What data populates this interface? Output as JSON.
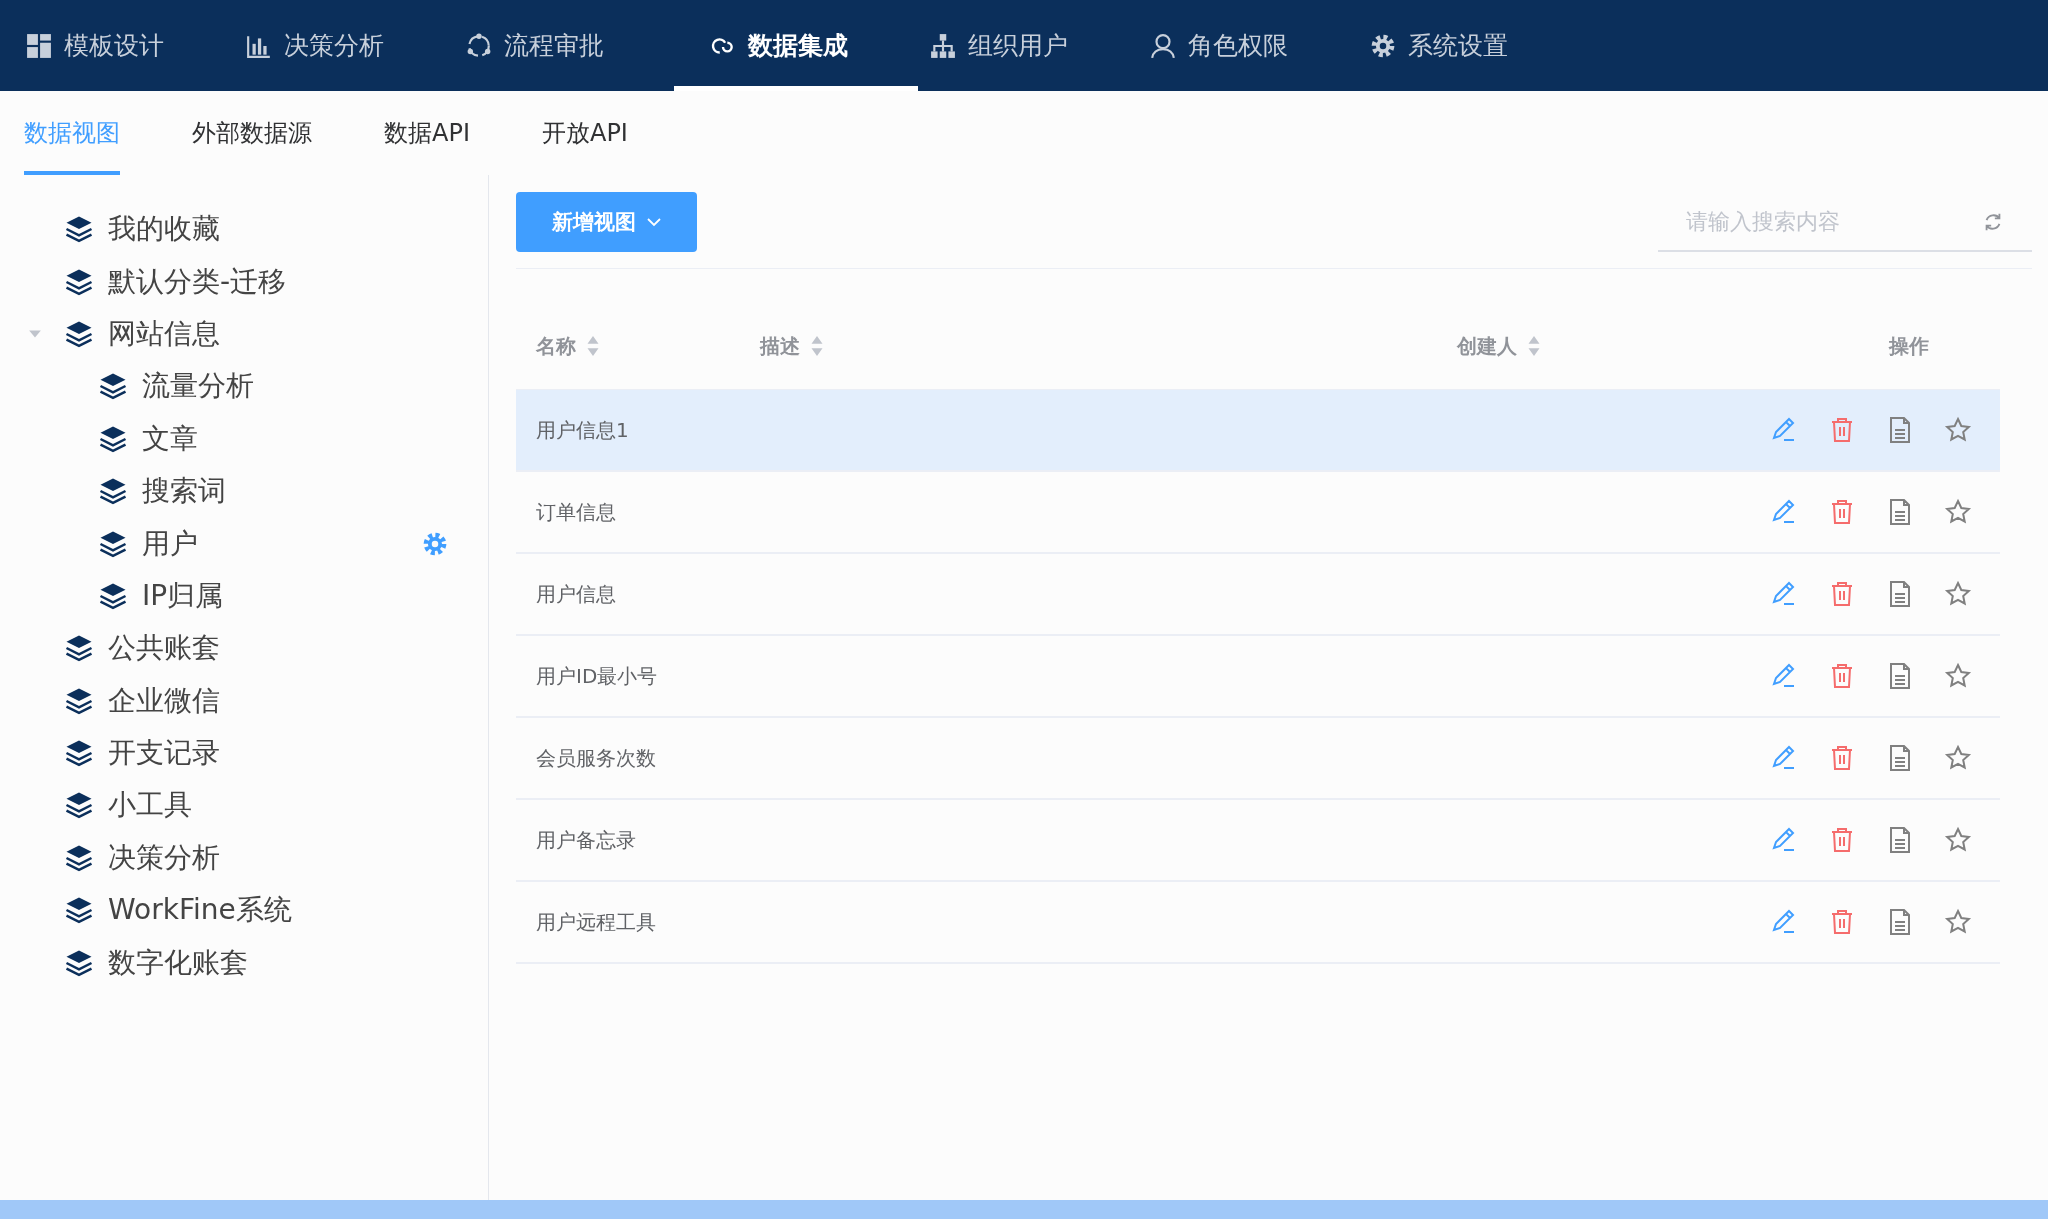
{
  "top_nav": [
    {
      "label": "模板设计",
      "kind": "grid",
      "selected": false
    },
    {
      "label": "决策分析",
      "kind": "chart",
      "selected": false
    },
    {
      "label": "流程审批",
      "kind": "cycle",
      "selected": false
    },
    {
      "label": "数据集成",
      "kind": "cloud",
      "selected": true
    },
    {
      "label": "组织用户",
      "kind": "org",
      "selected": false
    },
    {
      "label": "角色权限",
      "kind": "user",
      "selected": false
    },
    {
      "label": "系统设置",
      "kind": "gear",
      "selected": false
    }
  ],
  "sub_tabs": [
    {
      "label": "数据视图",
      "selected": true
    },
    {
      "label": "外部数据源",
      "selected": false
    },
    {
      "label": "数据API",
      "selected": false
    },
    {
      "label": "开放API",
      "selected": false
    }
  ],
  "sidebar": {
    "items": [
      {
        "label": "我的收藏",
        "hovered": false
      },
      {
        "label": "默认分类-迁移",
        "hovered": false
      },
      {
        "label": "网站信息",
        "hovered": false,
        "expanded": true,
        "children": [
          {
            "label": "流量分析",
            "hovered": false
          },
          {
            "label": "文章",
            "hovered": false
          },
          {
            "label": "搜索词",
            "hovered": false
          },
          {
            "label": "用户",
            "hovered": true
          },
          {
            "label": "IP归属",
            "hovered": false
          }
        ]
      },
      {
        "label": "公共账套",
        "hovered": false
      },
      {
        "label": "企业微信",
        "hovered": false
      },
      {
        "label": "开支记录",
        "hovered": false
      },
      {
        "label": "小工具",
        "hovered": false
      },
      {
        "label": "决策分析",
        "hovered": false
      },
      {
        "label": "WorkFine系统",
        "hovered": false
      },
      {
        "label": "数字化账套",
        "hovered": false
      }
    ]
  },
  "toolbar": {
    "add_button": "新增视图",
    "search": {
      "placeholder": "请输入搜索内容"
    }
  },
  "table": {
    "columns": [
      {
        "label": "名称",
        "sortable": true
      },
      {
        "label": "描述",
        "sortable": true
      },
      {
        "label": "创建人",
        "sortable": true
      },
      {
        "label": "操作",
        "sortable": false
      }
    ],
    "rows": [
      {
        "name": "用户信息1",
        "hovered": true
      },
      {
        "name": "订单信息",
        "hovered": false
      },
      {
        "name": "用户信息",
        "hovered": false
      },
      {
        "name": "用户ID最小号",
        "hovered": false
      },
      {
        "name": "会员服务次数",
        "hovered": false
      },
      {
        "name": "用户备忘录",
        "hovered": false
      },
      {
        "name": "用户远程工具",
        "hovered": false
      }
    ]
  }
}
